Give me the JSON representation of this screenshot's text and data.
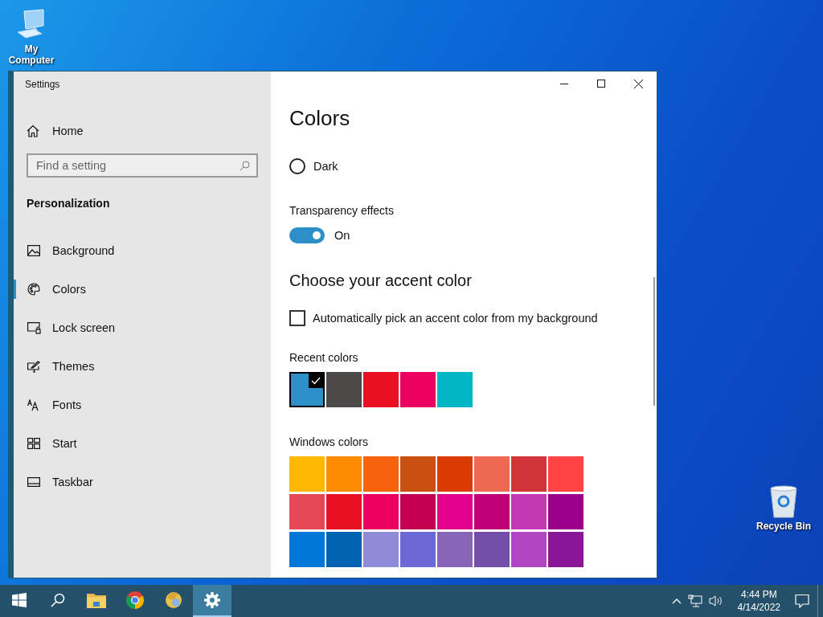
{
  "desktop_icons": [
    {
      "label": "My Computer",
      "kind": "computer"
    },
    {
      "label": "Recycle Bin",
      "kind": "bin"
    }
  ],
  "window": {
    "title": "Settings"
  },
  "sidebar": {
    "home": "Home",
    "search": {
      "placeholder": "Find a setting"
    },
    "section": "Personalization",
    "items": [
      {
        "label": "Background",
        "selected": false
      },
      {
        "label": "Colors",
        "selected": true
      },
      {
        "label": "Lock screen",
        "selected": false
      },
      {
        "label": "Themes",
        "selected": false
      },
      {
        "label": "Fonts",
        "selected": false
      },
      {
        "label": "Start",
        "selected": false
      },
      {
        "label": "Taskbar",
        "selected": false
      }
    ]
  },
  "content": {
    "heading": "Colors",
    "radios": [
      {
        "label": "Dark",
        "selected": false
      }
    ],
    "transparency": {
      "label": "Transparency effects",
      "on": true,
      "state_text": "On"
    },
    "accent_heading": "Choose your accent color",
    "auto_pick": {
      "label": "Automatically pick an accent color from my background",
      "checked": false
    },
    "recent_colors": {
      "label": "Recent colors",
      "swatches": [
        {
          "color": "#2d8fc8",
          "selected": true
        },
        {
          "color": "#4c4a48",
          "selected": false
        },
        {
          "color": "#e81123",
          "selected": false
        },
        {
          "color": "#ea005e",
          "selected": false
        },
        {
          "color": "#00b7c3",
          "selected": false
        }
      ]
    },
    "windows_colors": {
      "label": "Windows colors",
      "swatches": [
        {
          "color": "#ffb900"
        },
        {
          "color": "#ff8c00"
        },
        {
          "color": "#f7630c"
        },
        {
          "color": "#ca5010"
        },
        {
          "color": "#da3b01"
        },
        {
          "color": "#ef6950"
        },
        {
          "color": "#d13438"
        },
        {
          "color": "#ff4343"
        },
        {
          "color": "#e74856"
        },
        {
          "color": "#e81123"
        },
        {
          "color": "#ea005e"
        },
        {
          "color": "#c30052"
        },
        {
          "color": "#e3008c"
        },
        {
          "color": "#bf0077"
        },
        {
          "color": "#c239b3"
        },
        {
          "color": "#9a0089"
        },
        {
          "color": "#0078d7"
        },
        {
          "color": "#0063b1"
        },
        {
          "color": "#8e8cd8"
        },
        {
          "color": "#6b69d6"
        },
        {
          "color": "#8764b8"
        },
        {
          "color": "#744da9"
        },
        {
          "color": "#b146c2"
        },
        {
          "color": "#881798"
        }
      ]
    }
  },
  "taskbar": {
    "apps": [
      {
        "kind": "start",
        "selected": false
      },
      {
        "kind": "search",
        "selected": false
      },
      {
        "kind": "folder",
        "selected": false
      },
      {
        "kind": "chrome",
        "selected": false
      },
      {
        "kind": "orb",
        "selected": false
      },
      {
        "kind": "settings",
        "selected": true
      }
    ],
    "time": "4:44 PM",
    "date": "4/14/2022"
  }
}
